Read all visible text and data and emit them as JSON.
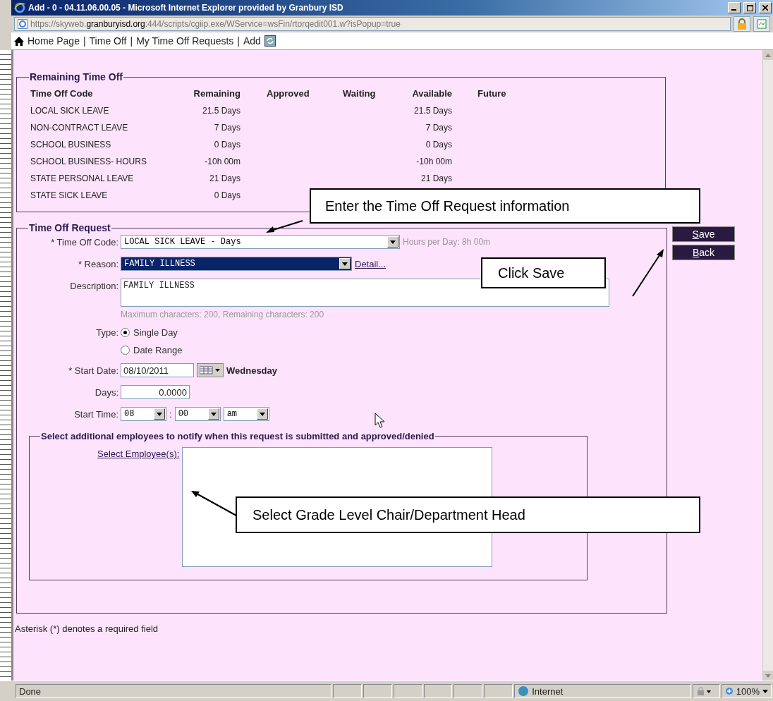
{
  "window": {
    "title": "Add - 0 - 04.11.06.00.05 - Microsoft Internet Explorer provided by Granbury ISD",
    "address": "https://skyweb.**granburyisd.org**:444/scripts/cgiip.exe/WService=wsFin/rtorqedit001.w?isPopup=true"
  },
  "breadcrumbs": {
    "separator": "|",
    "items": [
      "Home Page",
      "Time Off",
      "My Time Off Requests",
      "Add"
    ]
  },
  "remaining_time_off": {
    "legend": "Remaining Time Off",
    "columns": [
      "Time Off Code",
      "Remaining",
      "Approved",
      "Waiting",
      "Available",
      "Future"
    ],
    "rows": [
      {
        "code": "LOCAL SICK LEAVE",
        "remaining": "21.5 Days",
        "available": "21.5 Days"
      },
      {
        "code": "NON-CONTRACT LEAVE",
        "remaining": "7 Days",
        "available": "7 Days"
      },
      {
        "code": "SCHOOL BUSINESS",
        "remaining": "0 Days",
        "available": "0 Days"
      },
      {
        "code": "SCHOOL BUSINESS- HOURS",
        "remaining": "-10h 00m",
        "available": "-10h 00m"
      },
      {
        "code": "STATE PERSONAL LEAVE",
        "remaining": "21 Days",
        "available": "21 Days"
      },
      {
        "code": "STATE SICK LEAVE",
        "remaining": "0 Days"
      }
    ]
  },
  "time_off_request": {
    "legend": "Time Off Request",
    "time_off_code": {
      "label": "* Time Off Code:",
      "value": "LOCAL SICK LEAVE - Days",
      "hint": "Hours per Day: 8h 00m"
    },
    "reason": {
      "label": "* Reason:",
      "value": "FAMILY ILLNESS",
      "focused": true,
      "link": "Detail..."
    },
    "description": {
      "label": "Description:",
      "value": "FAMILY ILLNESS",
      "hint": "Maximum characters: 200, Remaining characters: 200"
    },
    "type": {
      "label": "Type:",
      "options": [
        {
          "label": "Single Day",
          "selected": true
        },
        {
          "label": "Date Range",
          "selected": false
        }
      ]
    },
    "start_date": {
      "label": "* Start Date:",
      "value": "08/10/2011",
      "weekday": "Wednesday"
    },
    "days": {
      "label": "Days:",
      "value": "0.0000"
    },
    "start_time": {
      "label": "Start Time:",
      "hour": "08",
      "separator": ":",
      "minute": "00",
      "ampm": "am"
    },
    "notify": {
      "legend": "Select additional employees to notify when this request is submitted and approved/denied",
      "link": "Select Employee(s):"
    }
  },
  "buttons": [
    "Save",
    "Back"
  ],
  "footnote": "Asterisk (*) denotes a required field",
  "callouts": [
    "Enter the Time Off Request information",
    "Click Save",
    "Select Grade Level Chair/Department Head"
  ],
  "status_bar": {
    "text": "Done",
    "zone": "Internet",
    "zoom": "100%"
  }
}
